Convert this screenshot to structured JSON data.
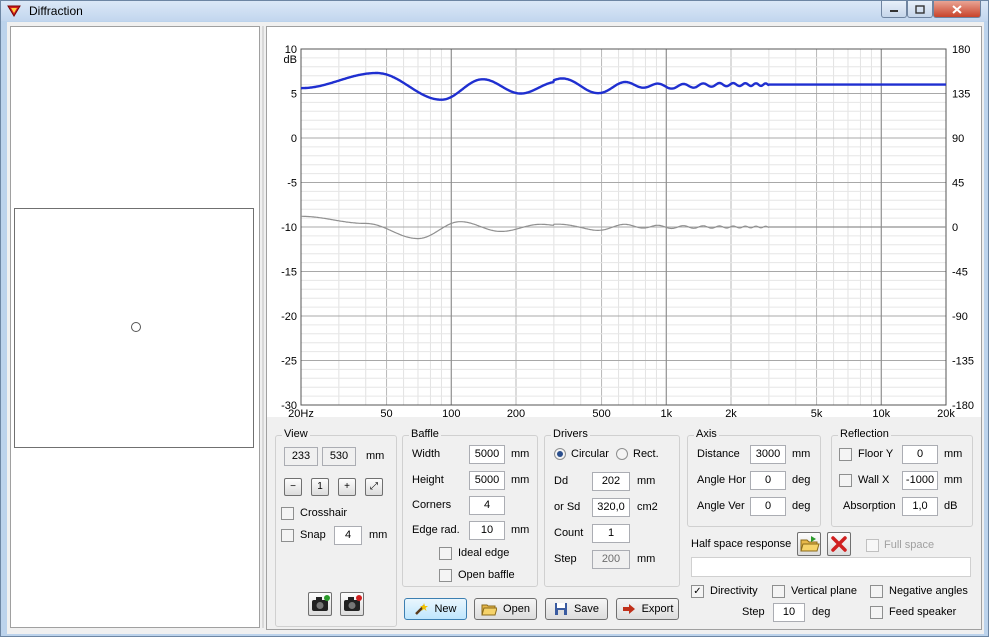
{
  "window": {
    "title": "Diffraction",
    "accent": "#1f3fbf"
  },
  "chart_data": {
    "type": "line",
    "xscale": "log",
    "xlim": [
      20,
      20000
    ],
    "ylim": [
      -30,
      10
    ],
    "y2lim": [
      -180,
      180
    ],
    "x_ticks": [
      "20Hz",
      "50",
      "100",
      "200",
      "500",
      "1k",
      "2k",
      "5k",
      "10k",
      "20k"
    ],
    "y_ticks": [
      "10",
      "5",
      "0",
      "-5",
      "-10",
      "-15",
      "-20",
      "-25",
      "-30"
    ],
    "y2_ticks": [
      "180",
      "135",
      "90",
      "45",
      "0",
      "-45",
      "-90",
      "-135",
      "-180"
    ],
    "ylabel": "dB",
    "grid": true,
    "series": [
      {
        "color": "#1f2fd0",
        "x": [
          20,
          45,
          90,
          140,
          210,
          310,
          450,
          700,
          1000,
          2000,
          5000,
          20000
        ],
        "values": [
          5.6,
          7.3,
          4.3,
          6.6,
          5.0,
          6.3,
          5.4,
          6.0,
          5.8,
          6.0,
          6.0,
          6.0
        ]
      },
      {
        "color": "#909090",
        "x": [
          20,
          40,
          70,
          110,
          170,
          260,
          400,
          700,
          1000,
          2000,
          20000
        ],
        "values": [
          -8.8,
          -9.6,
          -11.3,
          -9.4,
          -10.5,
          -9.7,
          -10.2,
          -9.9,
          -10.0,
          -10.0,
          -10.0
        ]
      }
    ]
  },
  "view": {
    "title": "View",
    "width": "233",
    "height": "530",
    "unit": "mm",
    "crosshair": "Crosshair",
    "snap": "Snap",
    "snap_value": "4",
    "snap_unit": "mm",
    "tools": [
      {
        "name": "zoom-out-icon",
        "glyph": "−"
      },
      {
        "name": "zoom-fit-icon",
        "glyph": "1"
      },
      {
        "name": "zoom-in-icon",
        "glyph": "+"
      },
      {
        "name": "full-view-icon",
        "glyph": "⤢"
      }
    ]
  },
  "baffle": {
    "title": "Baffle",
    "width_label": "Width",
    "width": "5000",
    "height_label": "Height",
    "height": "5000",
    "corners_label": "Corners",
    "corners": "4",
    "edge_label": "Edge rad.",
    "edge": "10",
    "unit": "mm",
    "ideal_edge": "Ideal edge",
    "open_baffle": "Open baffle"
  },
  "drivers": {
    "title": "Drivers",
    "circular": "Circular",
    "rect": "Rect.",
    "dd_label": "Dd",
    "dd": "202",
    "dd_unit": "mm",
    "sd_label": "or Sd",
    "sd": "320,0",
    "sd_unit": "cm2",
    "count_label": "Count",
    "count": "1",
    "step_label": "Step",
    "step": "200",
    "step_unit": "mm"
  },
  "axis": {
    "title": "Axis",
    "distance_label": "Distance",
    "distance": "3000",
    "distance_unit": "mm",
    "hor_label": "Angle Hor",
    "hor": "0",
    "ver_label": "Angle Ver",
    "ver": "0",
    "deg": "deg"
  },
  "reflection": {
    "title": "Reflection",
    "floor_label": "Floor Y",
    "floor": "0",
    "wall_label": "Wall  X",
    "wall": "-1000",
    "unit": "mm",
    "absorption_label": "Absorption",
    "absorption": "1,0",
    "absorption_unit": "dB"
  },
  "halfspace": {
    "label": "Half space response",
    "full_space": "Full space"
  },
  "options": {
    "directivity": "Directivity",
    "vertical_plane": "Vertical plane",
    "negative_angles": "Negative angles",
    "feed_speaker": "Feed speaker",
    "step_label": "Step",
    "step": "10",
    "step_unit": "deg"
  },
  "buttons": {
    "new": "New",
    "open": "Open",
    "save": "Save",
    "export": "Export"
  }
}
